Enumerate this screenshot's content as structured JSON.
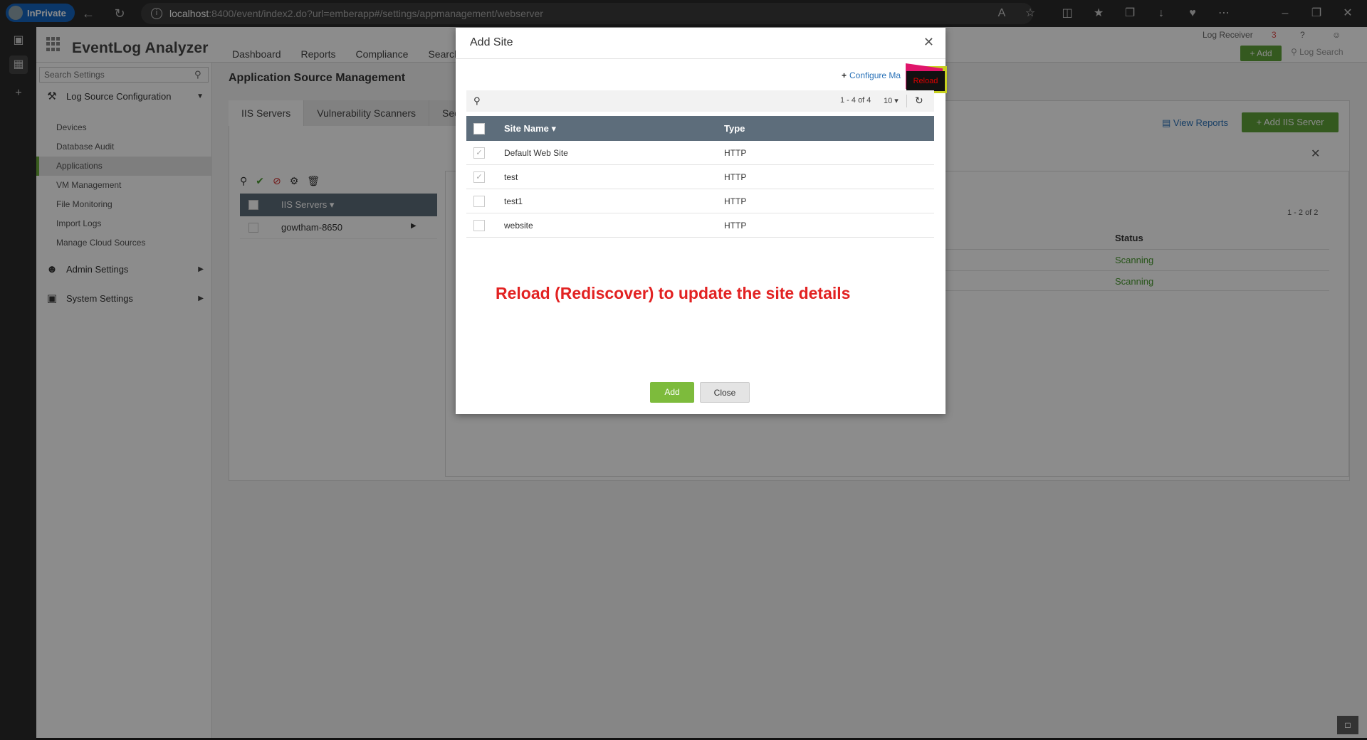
{
  "browser": {
    "inprivate_label": "InPrivate",
    "url_host": "localhost",
    "url_rest": ":8400/event/index2.do?url=emberapp#/settings/appmanagement/webserver"
  },
  "app": {
    "brand": "EventLog Analyzer",
    "nav": [
      "Dashboard",
      "Reports",
      "Compliance",
      "Search"
    ],
    "log_receiver": "Log Receiver",
    "add_button": "+ Add",
    "log_search": "Log Search",
    "help": "?",
    "notifications": "3"
  },
  "sidebar": {
    "search_placeholder": "Search Settings",
    "groups": {
      "log_source": "Log Source Configuration",
      "admin": "Admin Settings",
      "system": "System Settings"
    },
    "items": [
      "Devices",
      "Database Audit",
      "Applications",
      "VM Management",
      "File Monitoring",
      "Import Logs",
      "Manage Cloud Sources"
    ]
  },
  "main": {
    "title": "Application Source Management",
    "tabs": [
      "IIS Servers",
      "Vulnerability Scanners",
      "Sec"
    ],
    "view_reports": "View Reports",
    "add_iis": "+ Add IIS Server",
    "list_header": "IIS Servers",
    "list_rows": [
      "gowtham-8650"
    ],
    "detail_pager": "1 - 2 of 2",
    "status_header": "Status",
    "statuses": [
      "Scanning",
      "Scanning"
    ]
  },
  "modal": {
    "title": "Add Site",
    "configure_label": "Configure Ma",
    "reload_tooltip": "Reload",
    "pager": "1 - 4 of 4",
    "per_page": "10",
    "columns": [
      "Site Name",
      "Type"
    ],
    "rows": [
      {
        "name": "Default Web Site",
        "type": "HTTP",
        "checked": true
      },
      {
        "name": "test",
        "type": "HTTP",
        "checked": true
      },
      {
        "name": "test1",
        "type": "HTTP",
        "checked": false
      },
      {
        "name": "website",
        "type": "HTTP",
        "checked": false
      }
    ],
    "annotation": "Reload (Rediscover) to update the site details",
    "add_button": "Add",
    "close_button": "Close"
  },
  "colors": {
    "accent_green": "#5fa23a",
    "link_blue": "#2a72b8",
    "annotation_red": "#e22222",
    "table_header": "#5d6d7b"
  }
}
